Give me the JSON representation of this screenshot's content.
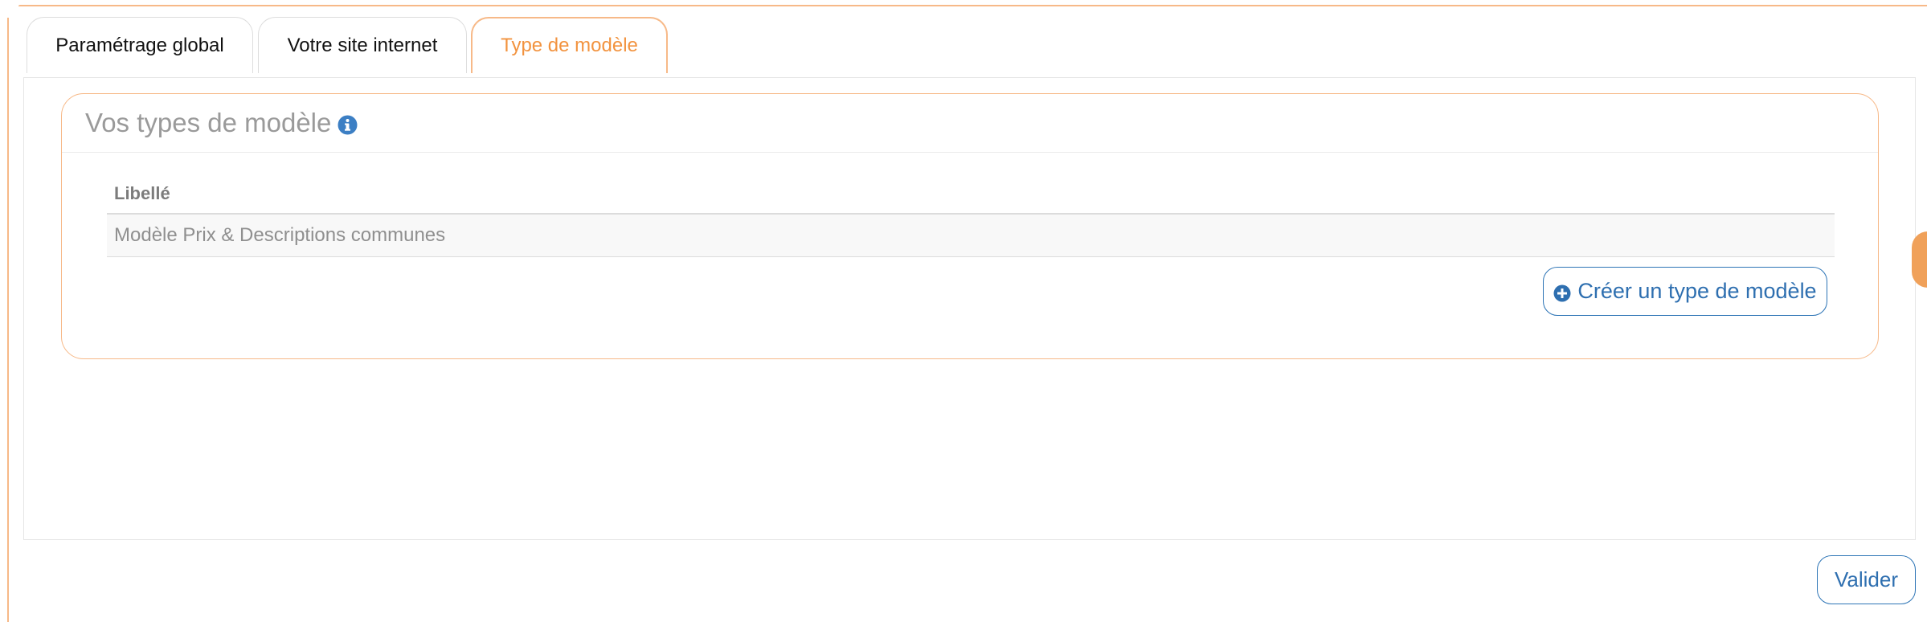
{
  "tabs": [
    {
      "label": "Paramétrage global",
      "active": false
    },
    {
      "label": "Votre site internet",
      "active": false
    },
    {
      "label": "Type de modèle",
      "active": true
    }
  ],
  "card": {
    "title": "Vos types de modèle",
    "info_icon": "info-circle-icon"
  },
  "table": {
    "header": "Libellé",
    "rows": [
      "Modèle Prix & Descriptions communes"
    ]
  },
  "create_button": {
    "label": "Créer un type de modèle",
    "icon": "plus-circle-icon"
  },
  "submit_button": {
    "label": "Valider"
  },
  "colors": {
    "accent_orange": "#f2933f",
    "accent_blue": "#2e75b6",
    "border_orange": "#f7b988"
  }
}
